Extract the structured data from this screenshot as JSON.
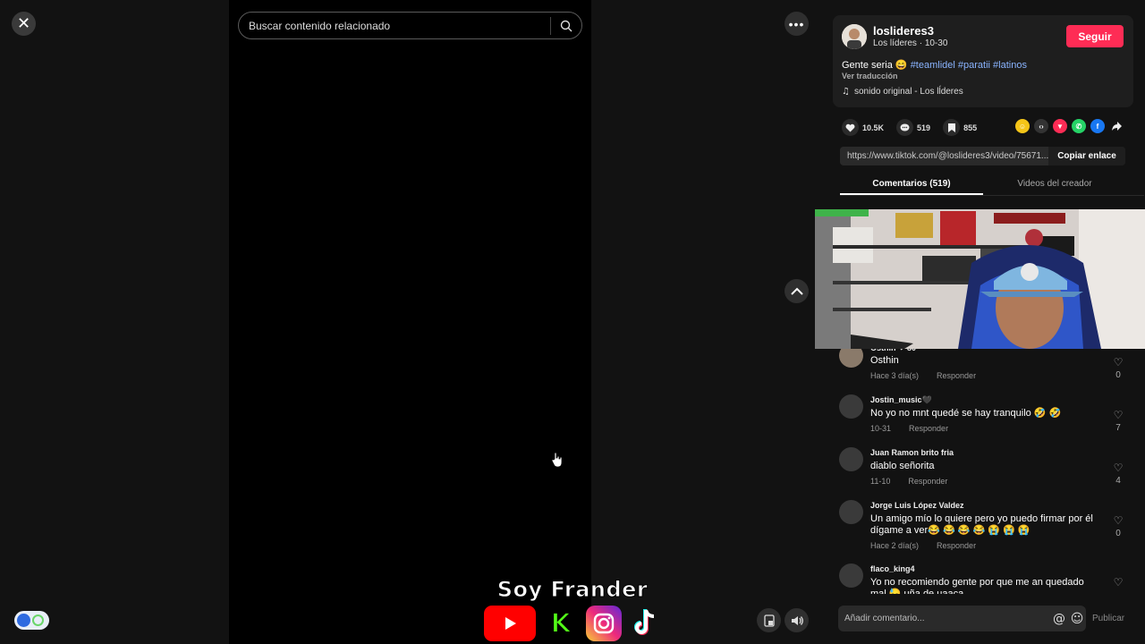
{
  "search": {
    "placeholder": "Buscar contenido relacionado"
  },
  "brand": {
    "title": "Soy Frander"
  },
  "author": {
    "username": "loslideres3",
    "display_name": "Los líderes",
    "date": "10-30",
    "follow_label": "Seguir"
  },
  "post": {
    "caption_text": "Gente seria 😄",
    "hashtags": [
      "#teamlidel",
      "#paratii",
      "#latinos"
    ],
    "translate_label": "Ver traducción",
    "music": "sonido original - Los lĺderes"
  },
  "stats": {
    "likes": "10.5K",
    "comments": "519",
    "saves": "855"
  },
  "share": {
    "url": "https://www.tiktok.com/@loslideres3/video/75671...",
    "copy_label": "Copiar enlace"
  },
  "tabs": {
    "comments": "Comentarios (519)",
    "creator_videos": "Videos del creador"
  },
  "comments": [
    {
      "user": "Osthin ❤ 80",
      "text": "Osthin",
      "time": "Hace 3 día(s)",
      "reply": "Responder",
      "likes": "0"
    },
    {
      "user": "Jostin_music🖤",
      "text": "No yo no mnt quedé se hay tranquilo 🤣 🤣",
      "time": "10-31",
      "reply": "Responder",
      "likes": "7"
    },
    {
      "user": "Juan Ramon brito fria",
      "text": "diablo señorita",
      "time": "11-10",
      "reply": "Responder",
      "likes": "4"
    },
    {
      "user": "Jorge Luis López Valdez",
      "text": "Un amigo mío lo quiere pero yo puedo firmar por él dígame a ver😂 😂 😂 😂 😭 😭 😭",
      "time": "Hace 2 día(s)",
      "reply": "Responder",
      "likes": "0"
    },
    {
      "user": "flaco_king4",
      "text": "Yo no recomiendo gente por que me an quedado mal 😓 uña de uaaca",
      "time": "",
      "reply": "",
      "likes": ""
    }
  ],
  "composer": {
    "placeholder": "Añadir comentario...",
    "post_label": "Publicar"
  },
  "colors": {
    "accent": "#fe2c55",
    "hashtag": "#8ab4ff",
    "background": "#121212"
  }
}
